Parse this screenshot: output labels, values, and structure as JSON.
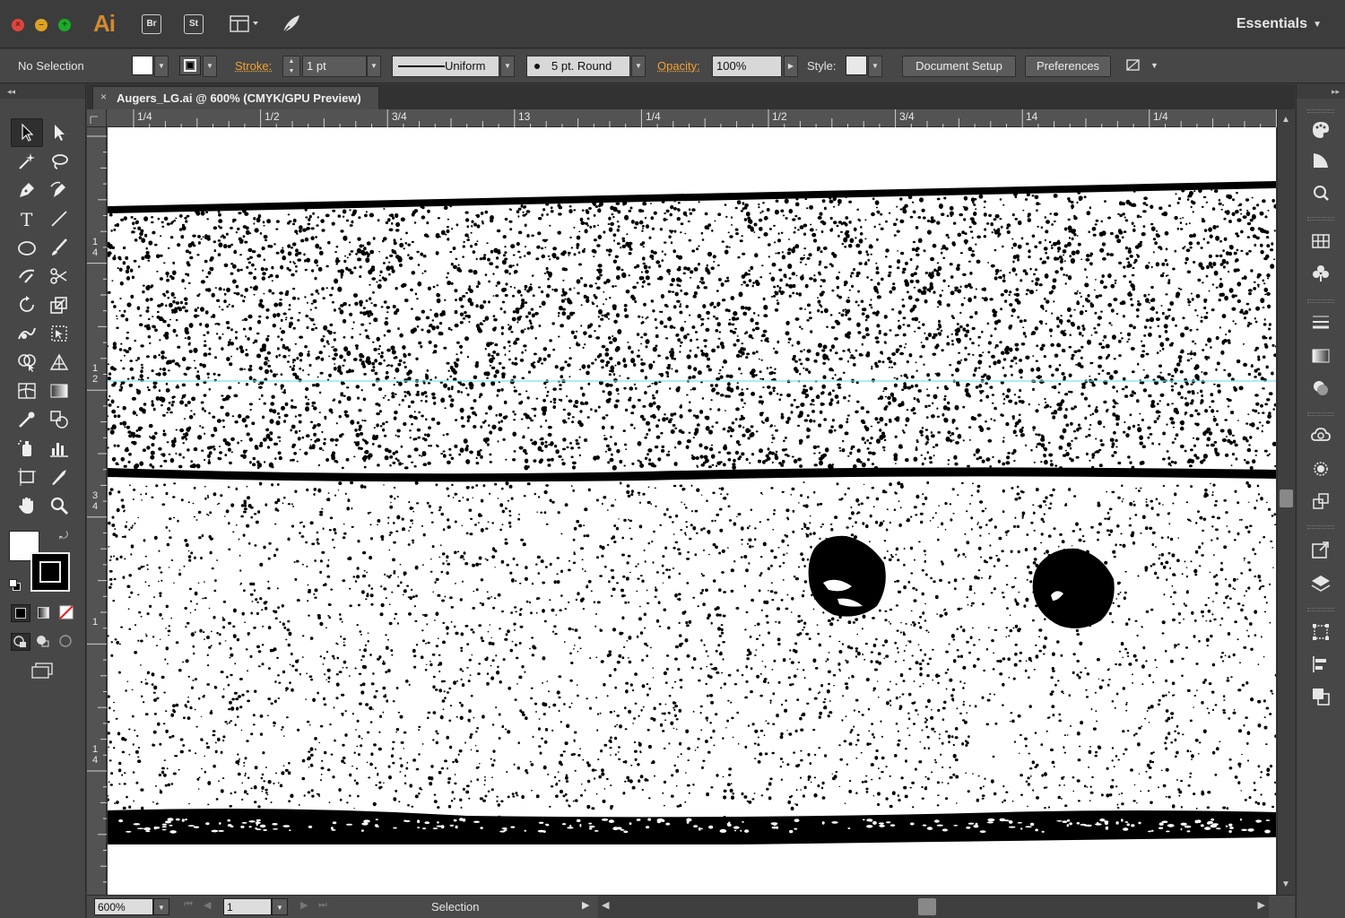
{
  "app": {
    "logo": "Ai",
    "bridge_label": "Br",
    "stock_label": "St",
    "workspace": "Essentials"
  },
  "control_bar": {
    "selection_status": "No Selection",
    "stroke_label": "Stroke:",
    "stroke_weight": "1 pt",
    "stroke_profile": "Uniform",
    "brush": "5 pt. Round",
    "opacity_label": "Opacity:",
    "opacity_value": "100%",
    "style_label": "Style:",
    "document_setup": "Document Setup",
    "preferences": "Preferences"
  },
  "document": {
    "tab_title": "Augers_LG.ai @ 600% (CMYK/GPU Preview)",
    "close_glyph": "×"
  },
  "rulers": {
    "horizontal": [
      "1/4",
      "1/2",
      "3/4",
      "13",
      "1/4",
      "1/2",
      "3/4",
      "14",
      "1/4"
    ],
    "vertical": [
      "1 4",
      "1 2",
      "3 4",
      "1",
      "1 4"
    ]
  },
  "status_bar": {
    "zoom": "600%",
    "page": "1",
    "tool_status": "Selection"
  },
  "colors": {
    "accent_orange": "#f0a334",
    "guide_cyan": "#7fe0ea",
    "panel_bg": "#474747",
    "canvas": "#ffffff",
    "ink": "#000000"
  },
  "tools": [
    "selection-tool-icon",
    "direct-selection-tool-icon",
    "magic-wand-tool-icon",
    "lasso-tool-icon",
    "pen-tool-icon",
    "curvature-tool-icon",
    "type-tool-icon",
    "line-segment-tool-icon",
    "ellipse-tool-icon",
    "paintbrush-tool-icon",
    "shaper-tool-icon",
    "scissors-tool-icon",
    "rotate-tool-icon",
    "scale-tool-icon",
    "warp-tool-icon",
    "free-transform-tool-icon",
    "shape-builder-tool-icon",
    "perspective-grid-tool-icon",
    "mesh-tool-icon",
    "gradient-tool-icon",
    "eyedropper-tool-icon",
    "blend-tool-icon",
    "symbol-sprayer-tool-icon",
    "column-graph-tool-icon",
    "artboard-tool-icon",
    "slice-tool-icon",
    "hand-tool-icon",
    "zoom-tool-icon"
  ]
}
